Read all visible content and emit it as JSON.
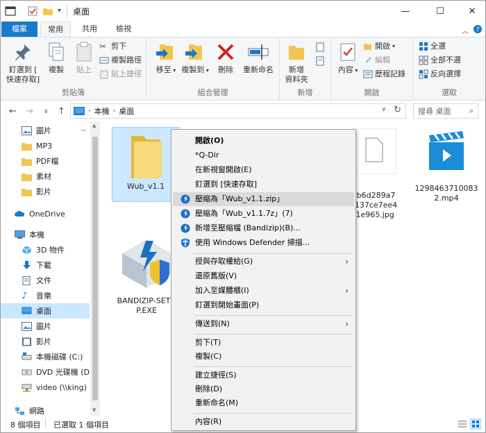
{
  "window": {
    "title": "桌面",
    "minimize": "—",
    "maximize": "☐",
    "close": "✕"
  },
  "ribbon_tabs": [
    "檔案",
    "常用",
    "共用",
    "檢視"
  ],
  "ribbon": {
    "clipboard": {
      "label": "剪貼簿",
      "pin": "釘選到 [\n快速存取]",
      "copy": "複製",
      "paste": "貼上",
      "cut": "剪下",
      "copy_path": "複製路徑",
      "paste_shortcut": "貼上捷徑"
    },
    "organize": {
      "label": "組合管理",
      "move_to": "移至",
      "copy_to": "複製到",
      "delete": "刪除",
      "rename": "重新命名"
    },
    "new": {
      "label": "新增",
      "new_folder": "新增\n資料夾"
    },
    "open": {
      "label": "開啟",
      "properties": "內容",
      "open": "開啟",
      "edit": "編輯",
      "history": "歷程記錄"
    },
    "select": {
      "label": "選取",
      "select_all": "全選",
      "select_none": "全部不選",
      "invert": "反向選擇"
    }
  },
  "address": {
    "path": [
      "本機",
      "桌面"
    ],
    "search_placeholder": "搜尋 桌面"
  },
  "nav": {
    "items": [
      {
        "label": "圖片",
        "icon": "pictures-icon"
      },
      {
        "label": "MP3",
        "icon": "folder-icon"
      },
      {
        "label": "PDF檔",
        "icon": "folder-icon"
      },
      {
        "label": "素材",
        "icon": "folder-icon"
      },
      {
        "label": "影片",
        "icon": "folder-icon"
      },
      {
        "label": "OneDrive",
        "icon": "cloud-icon"
      },
      {
        "label": "本機",
        "icon": "computer-icon"
      },
      {
        "label": "3D 物件",
        "icon": "cube-icon"
      },
      {
        "label": "下載",
        "icon": "download-icon"
      },
      {
        "label": "文件",
        "icon": "document-icon"
      },
      {
        "label": "音樂",
        "icon": "music-icon"
      },
      {
        "label": "桌面",
        "icon": "desktop-icon"
      },
      {
        "label": "圖片",
        "icon": "pictures-icon"
      },
      {
        "label": "影片",
        "icon": "video-icon"
      },
      {
        "label": "本機磁碟 (C:)",
        "icon": "drive-icon"
      },
      {
        "label": "DVD 光碟機 (D",
        "icon": "dvd-icon"
      },
      {
        "label": "video (\\\\king)",
        "icon": "network-drive-icon"
      },
      {
        "label": "網路",
        "icon": "network-icon"
      }
    ]
  },
  "files": [
    {
      "name": "Wub_v1.1",
      "type": "folder"
    },
    {
      "name": "BANDIZIP-SETU\nP.EXE",
      "type": "exe"
    },
    {
      "name": "db6d289a7\n0137ce7ee4\n)1e965.jpg",
      "type": "jpg"
    },
    {
      "name": "1298463710083\n2.mp4",
      "type": "mp4"
    }
  ],
  "status": {
    "count": "8 個項目",
    "selected": "已選取 1 個項目"
  },
  "context_menu": {
    "items": [
      {
        "label": "開啟(O)",
        "bold": true
      },
      {
        "label": "*Q-Dir"
      },
      {
        "label": "在新視窗開啟(E)"
      },
      {
        "label": "釘選到 [快速存取]"
      },
      {
        "label": "壓縮為「Wub_v1.1.zip」",
        "icon": "bandizip-icon",
        "hover": true
      },
      {
        "label": "壓縮為「Wub_v1.1.7z」(7)",
        "icon": "bandizip-icon"
      },
      {
        "label": "新增至壓縮檔 (Bandizip)(B)...",
        "icon": "bandizip-icon"
      },
      {
        "label": "使用 Windows Defender 掃描...",
        "icon": "defender-icon"
      },
      {
        "label": "授與存取權給(G)",
        "submenu": true
      },
      {
        "label": "還原舊版(V)"
      },
      {
        "label": "加入至媒體櫃(I)",
        "submenu": true
      },
      {
        "label": "釘選到開始畫面(P)"
      },
      {
        "label": "傳送到(N)",
        "submenu": true
      },
      {
        "label": "剪下(T)"
      },
      {
        "label": "複製(C)"
      },
      {
        "label": "建立捷徑(S)"
      },
      {
        "label": "刪除(D)"
      },
      {
        "label": "重新命名(M)"
      },
      {
        "label": "內容(R)"
      }
    ]
  }
}
